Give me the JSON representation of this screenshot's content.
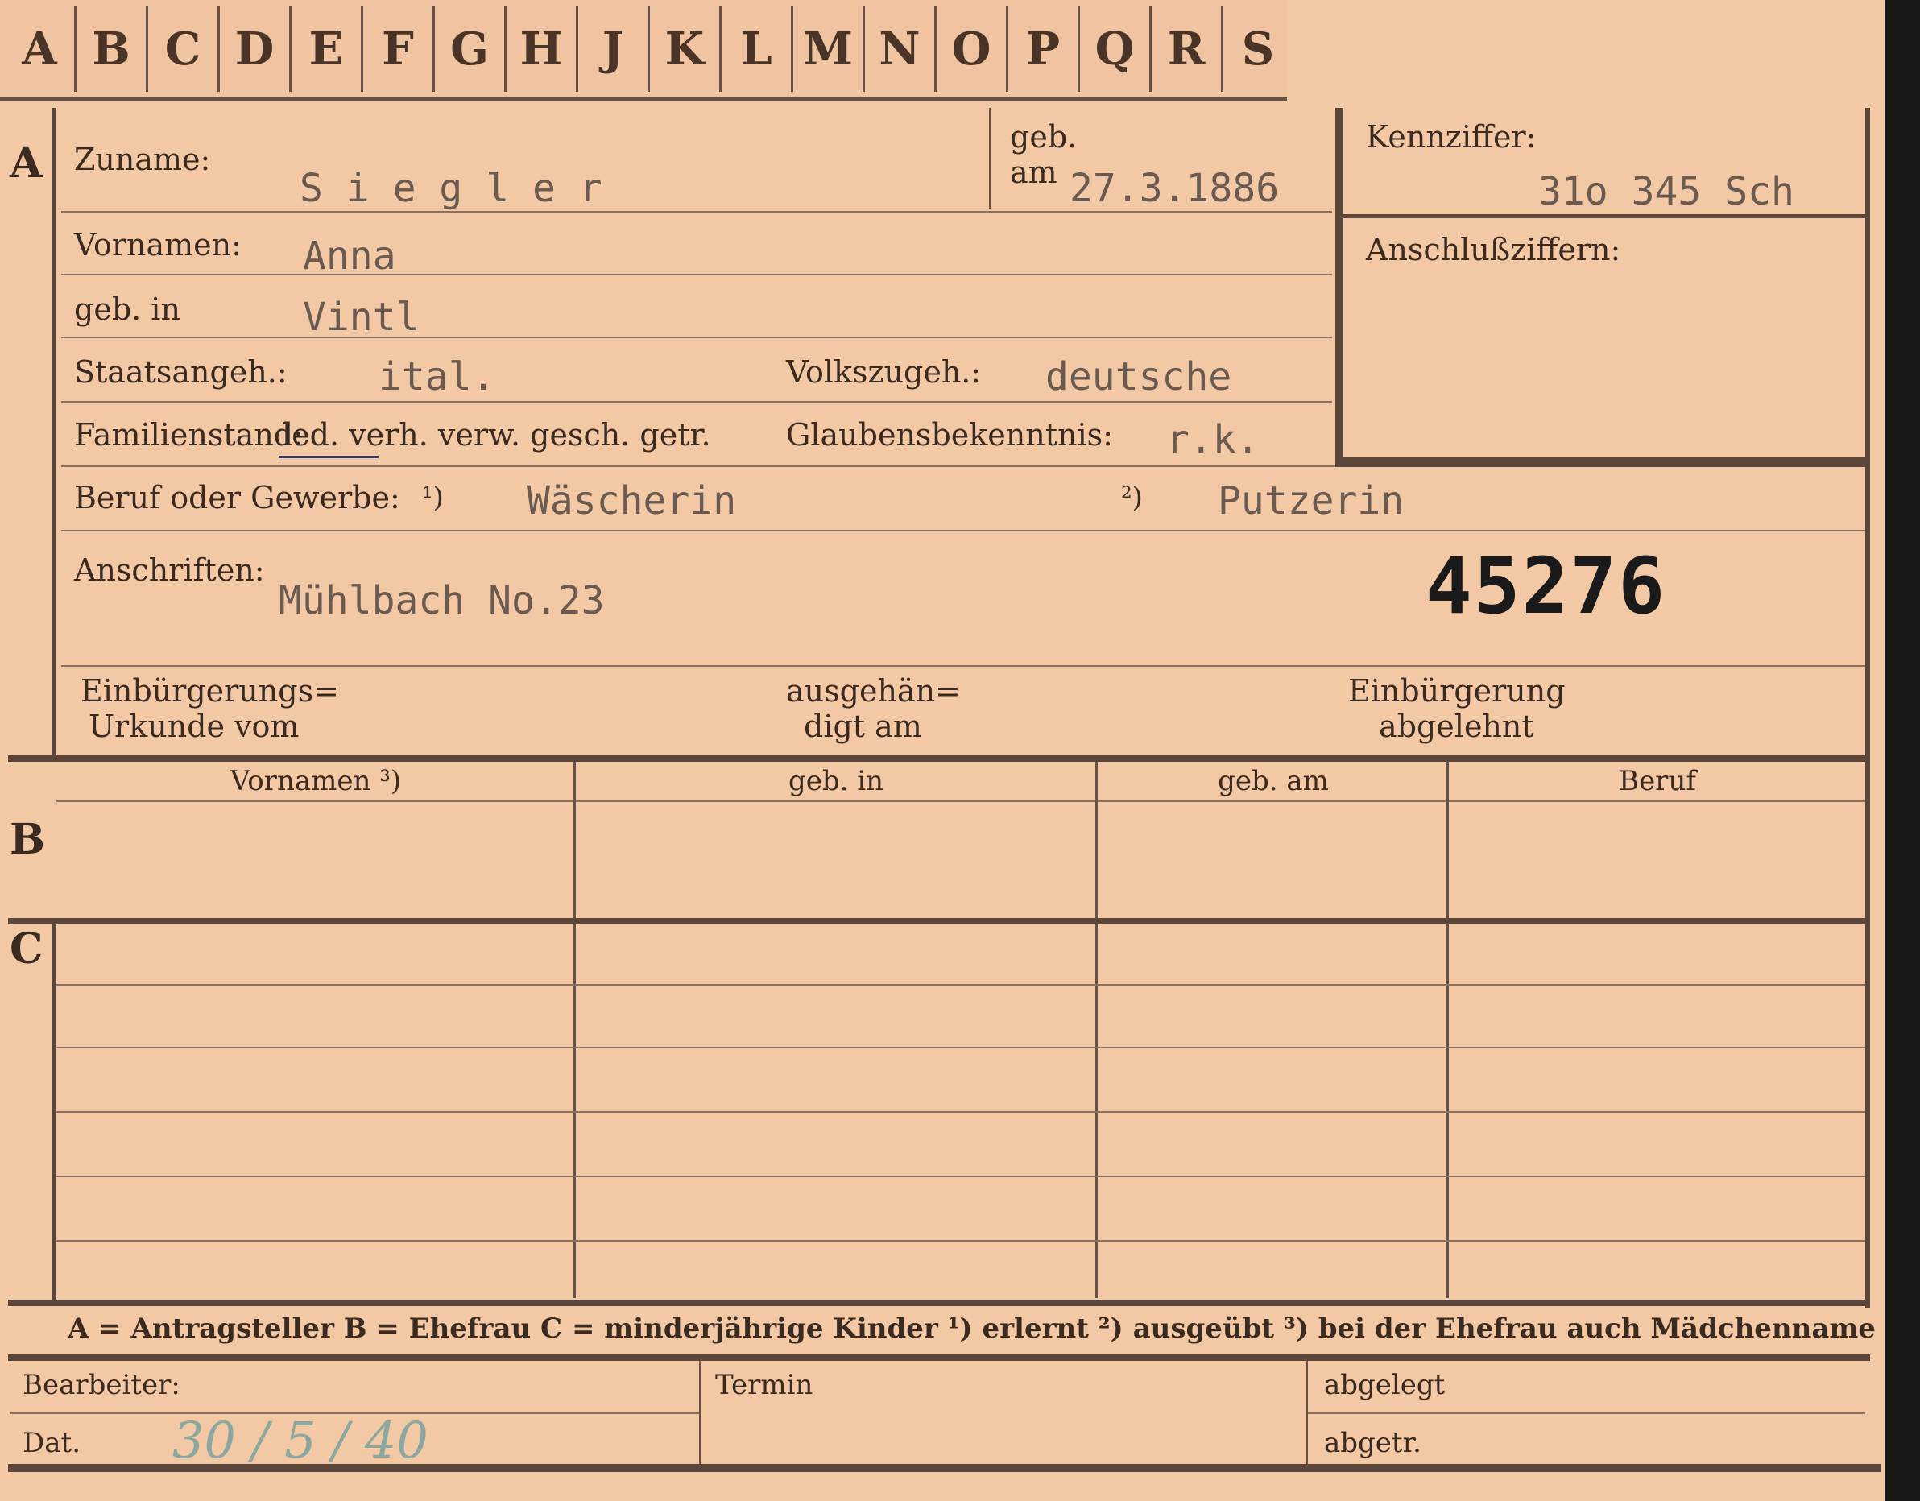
{
  "tabs": [
    "A",
    "B",
    "C",
    "D",
    "E",
    "F",
    "G",
    "H",
    "J",
    "K",
    "L",
    "M",
    "N",
    "O",
    "P",
    "Q",
    "R",
    "S"
  ],
  "section_a": {
    "marker": "A",
    "surname_label": "Zuname:",
    "surname_value": "S i e g l e r",
    "birthdate_label_1": "geb.",
    "birthdate_label_2": "am",
    "birthdate_value": "27.3.1886",
    "kennziffer_label": "Kennziffer:",
    "kennziffer_value": "31o 345   Sch",
    "anschluss_label": "Anschlußziffern:",
    "firstnames_label": "Vornamen:",
    "firstnames_value": "Anna",
    "birthplace_label": "geb. in",
    "birthplace_value": "Vintl",
    "citizenship_label": "Staatsangeh.:",
    "citizenship_value": "ital.",
    "ethnicity_label": "Volkszugeh.:",
    "ethnicity_value": "deutsche",
    "marital_label": "Familienstand:",
    "marital_options": "led. verh. verw. gesch. getr.",
    "religion_label": "Glaubensbekenntnis:",
    "religion_value": "r.k.",
    "occupation_label": "Beruf oder Gewerbe:",
    "occupation_note1": "¹)",
    "occupation_value1": "Wäscherin",
    "occupation_note2": "²)",
    "occupation_value2": "Putzerin",
    "address_label": "Anschriften:",
    "address_value": "Mühlbach No.23",
    "stamp_number": "45276",
    "natur_label_1": "Einbürgerungs=",
    "natur_label_2": "Urkunde vom",
    "handed_label_1": "ausgehän=",
    "handed_label_2": "digt am",
    "refused_label_1": "Einbürgerung",
    "refused_label_2": "abgelehnt"
  },
  "section_b": {
    "marker": "B",
    "columns": [
      "Vornamen ³)",
      "geb. in",
      "geb. am",
      "Beruf"
    ]
  },
  "section_c": {
    "marker": "C"
  },
  "legend": "A = Antragsteller   B = Ehefrau   C = minderjährige Kinder   ¹) erlernt   ²) ausgeübt   ³) bei der Ehefrau auch Mädchenname",
  "footer": {
    "bearbeiter_label": "Bearbeiter:",
    "dat_label": "Dat.",
    "dat_value": "30 / 5 / 40",
    "termin_label": "Termin",
    "abgelegt_label": "abgelegt",
    "abgetr_label": "abgetr."
  }
}
